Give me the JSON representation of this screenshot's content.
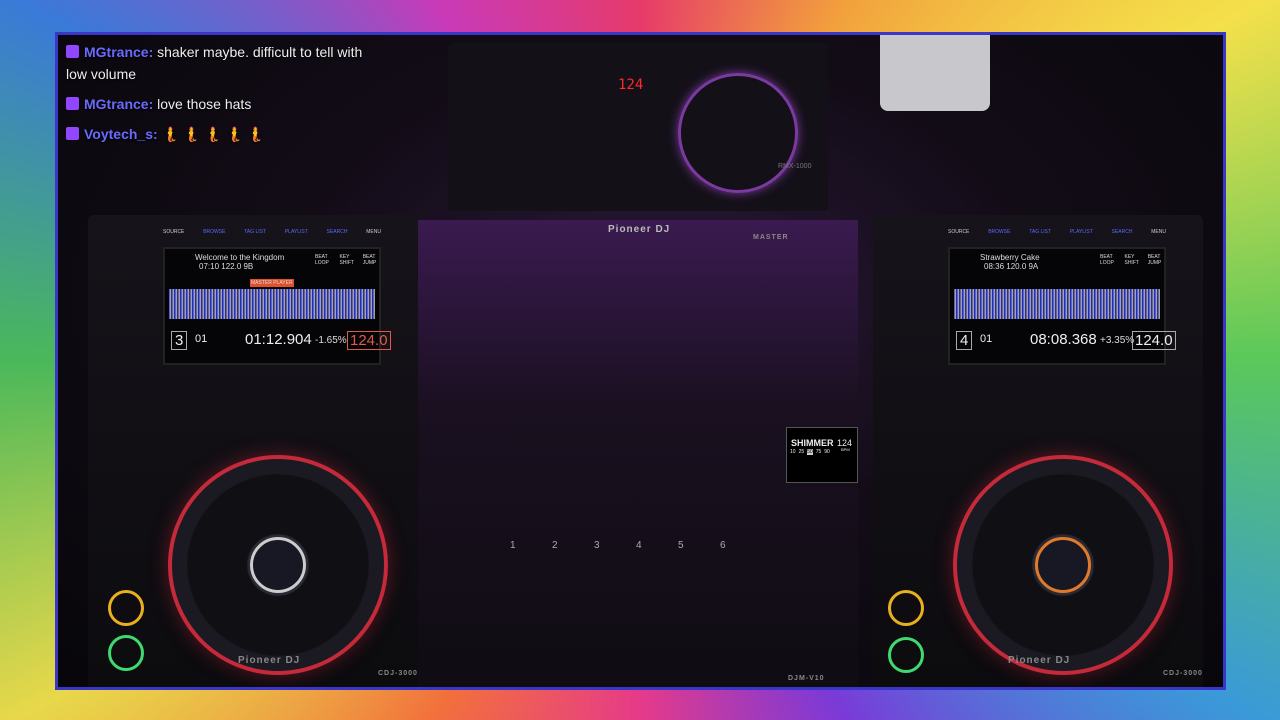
{
  "chat": [
    {
      "user": "MGtrance",
      "text": "shaker maybe. difficult to tell with low volume"
    },
    {
      "user": "MGtrance",
      "text": "love those hats"
    },
    {
      "user": "Voytech_s",
      "text": "🧜 🧜 🧜 🧜 🧜"
    }
  ],
  "brand": "Pioneer DJ",
  "screen_tabs": [
    "SOURCE",
    "BROWSE",
    "TAG LIST",
    "PLAYLIST",
    "SEARCH",
    "MENU"
  ],
  "screen_buttons": [
    "BEAT LOOP",
    "KEY SHIFT",
    "BEAT JUMP"
  ],
  "decks": [
    {
      "model": "CDJ-3000",
      "player": "3",
      "track_title": "Welcome to the Kingdom",
      "track_info": "07:10  122.0  9B",
      "status": "MASTER PLAYER",
      "track_no": "01",
      "time": "01:12.904",
      "tempo": "-1.65%",
      "bpm": "124.0"
    },
    {
      "model": "CDJ-3000",
      "player": "4",
      "track_title": "Strawberry Cake",
      "track_info": "08:36  120.0  9A",
      "status": "",
      "track_no": "01",
      "time": "08:08.368",
      "tempo": "+3.35%",
      "bpm": "124.0"
    }
  ],
  "mixer": {
    "model": "DJM-V10",
    "master": "MASTER",
    "channels": [
      "1",
      "2",
      "3",
      "4",
      "5",
      "6"
    ],
    "beat_fx": {
      "name": "SHIMMER",
      "bpm": "124",
      "bpm_unit": "BPM",
      "values": [
        "10",
        "25",
        "50",
        "75",
        "90"
      ]
    }
  },
  "rmx": {
    "model": "RMX-1000",
    "bpm": "124"
  }
}
